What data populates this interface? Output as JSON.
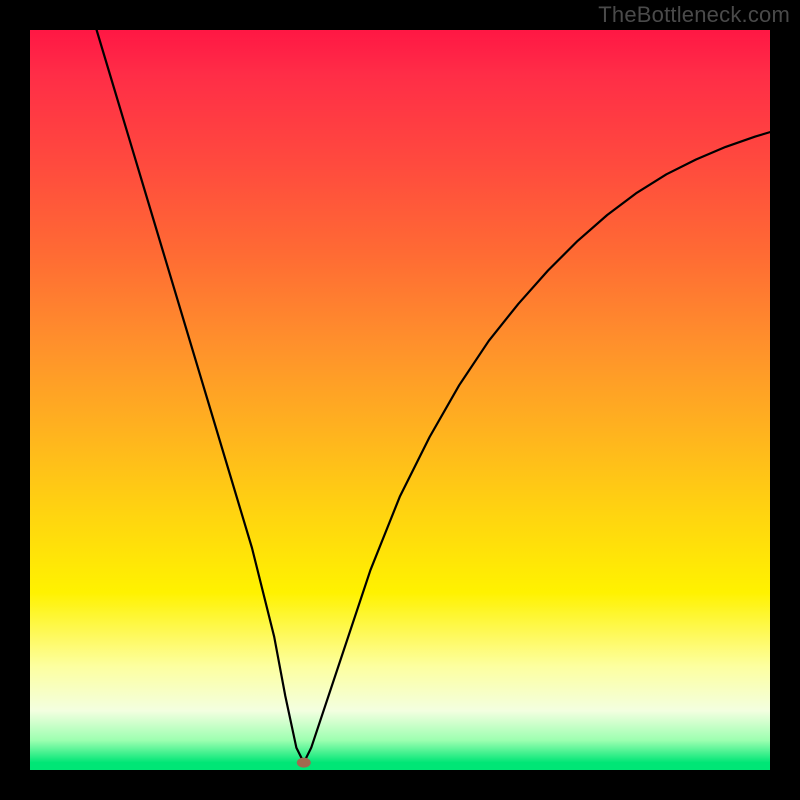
{
  "watermark": "TheBottleneck.com",
  "chart_data": {
    "type": "line",
    "title": "",
    "xlabel": "",
    "ylabel": "",
    "xlim": [
      0,
      100
    ],
    "ylim": [
      0,
      100
    ],
    "grid": false,
    "series": [
      {
        "name": "curve",
        "x": [
          9,
          12,
          15,
          18,
          21,
          24,
          27,
          30,
          33,
          34.5,
          36,
          37,
          38,
          42,
          46,
          50,
          54,
          58,
          62,
          66,
          70,
          74,
          78,
          82,
          86,
          90,
          94,
          98,
          100
        ],
        "y": [
          100,
          90,
          80,
          70,
          60,
          50,
          40,
          30,
          18,
          10,
          3,
          1,
          3,
          15,
          27,
          37,
          45,
          52,
          58,
          63,
          67.5,
          71.5,
          75,
          78,
          80.5,
          82.5,
          84.2,
          85.6,
          86.2
        ]
      }
    ],
    "marker": {
      "x": 37,
      "y": 1
    }
  },
  "colors": {
    "frame": "#000000",
    "watermark": "#4a4a4a",
    "curve": "#000000",
    "marker": "#a1694f",
    "gradient_stops": [
      "#ff1744",
      "#ff8f2c",
      "#fff200",
      "#00e676"
    ]
  }
}
